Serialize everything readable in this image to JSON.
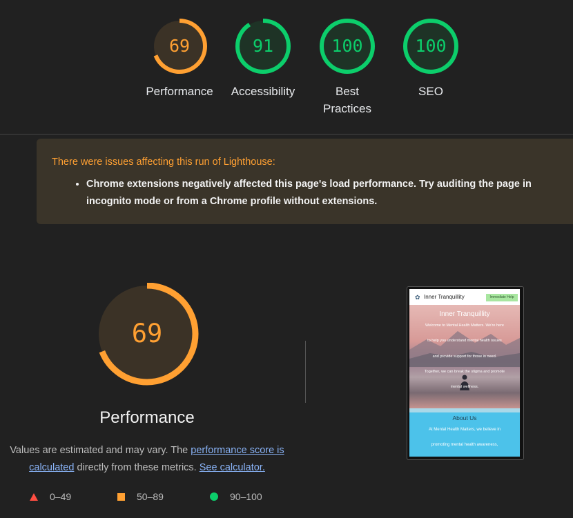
{
  "gauges": [
    {
      "score": "69",
      "label_line1": "Performance",
      "label_line2": "",
      "value": 69,
      "color": "#ffa032",
      "track": "#3b3226"
    },
    {
      "score": "91",
      "label_line1": "Accessibility",
      "label_line2": "",
      "value": 91,
      "color": "#0cce6b",
      "track": "#1e3326"
    },
    {
      "score": "100",
      "label_line1": "Best",
      "label_line2": "Practices",
      "value": 100,
      "color": "#0cce6b",
      "track": "#1e3326"
    },
    {
      "score": "100",
      "label_line1": "SEO",
      "label_line2": "",
      "value": 100,
      "color": "#0cce6b",
      "track": "#1e3326"
    }
  ],
  "warning": {
    "title": "There were issues affecting this run of Lighthouse:",
    "items": [
      "Chrome extensions negatively affected this page's load performance. Try auditing the page in incognito mode or from a Chrome profile without extensions."
    ]
  },
  "performance": {
    "score": "69",
    "value": 69,
    "title": "Performance",
    "note_text_1": "Values are estimated and may vary. The ",
    "note_link_1": "performance score is calculated",
    "note_text_2": " directly from these metrics. ",
    "note_link_2": "See calculator."
  },
  "legend": [
    {
      "shape": "triangle",
      "range": "0–49",
      "color": "#ff4e42"
    },
    {
      "shape": "square",
      "range": "50–89",
      "color": "#ffa032"
    },
    {
      "shape": "circle",
      "range": "90–100",
      "color": "#0cce6b"
    }
  ],
  "screenshot": {
    "brand": "Inner Tranquillity",
    "help_button": "Immediate Help",
    "hero_title": "Inner Tranquillity",
    "hero_lines": [
      "Welcome to Mental Health Matters. We're here",
      "to help you understand mental health issues",
      "and provide support for those in need.",
      "Together, we can break the stigma and promote",
      "mental wellness."
    ],
    "about_title": "About Us",
    "about_lines": [
      "At Mental Health Matters, we believe in",
      "promoting mental health awareness,"
    ]
  }
}
